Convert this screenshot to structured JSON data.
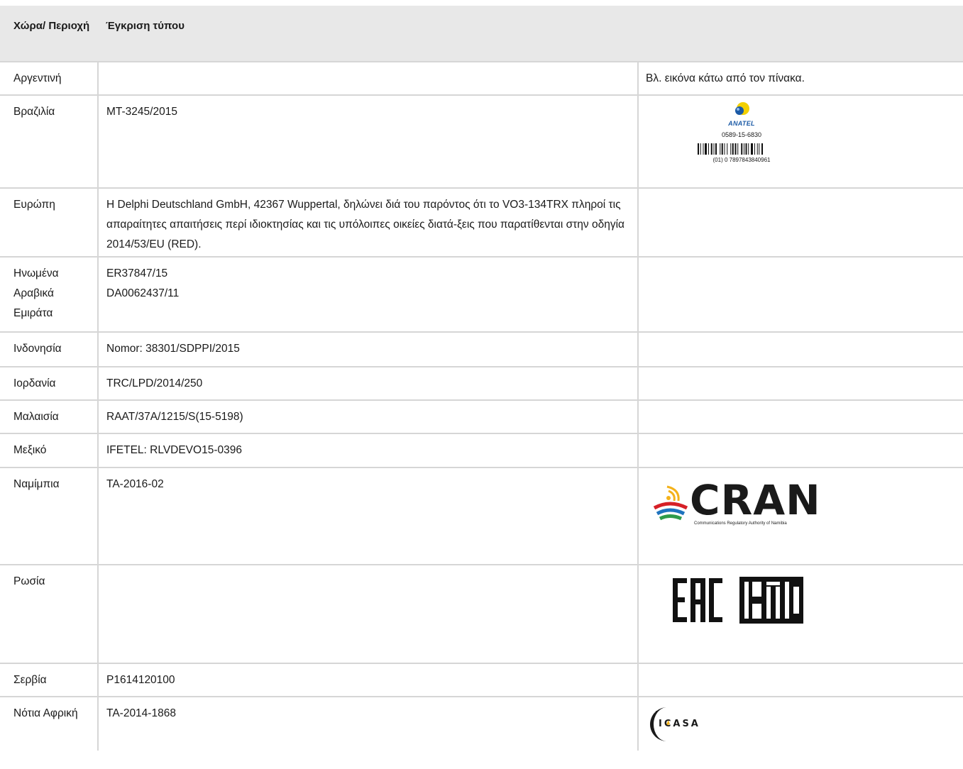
{
  "header": {
    "col_country": "Χώρα/ Περιοχή",
    "col_approval": "Έγκριση τύπου"
  },
  "rows": [
    {
      "country": "Αργεντινή",
      "approval": "",
      "note": "Βλ. εικόνα κάτω από τον πίνακα."
    },
    {
      "country": "Βραζιλία",
      "approval": "MT-3245/2015",
      "logo": {
        "type": "anatel",
        "wordmark": "ANATEL",
        "number": "0589-15-6830",
        "barcode_text": "(01) 0 7897843840961"
      }
    },
    {
      "country": "Ευρώπη",
      "approval": "H Delphi Deutschland GmbH, 42367 Wuppertal, δηλώνει διά του παρόντος ότι το VO3-134TRX πληροί τις απαραίτητες απαιτήσεις περί ιδιοκτησίας και τις υπόλοιπες οικείες διατά-ξεις που παρατίθενται στην οδηγία 2014/53/EU (RED)."
    },
    {
      "country": "Ηνωμένα Αραβικά Εμιράτα",
      "approval_lines": [
        "ER37847/15",
        "DA0062437/11"
      ]
    },
    {
      "country": "Ινδονησία",
      "approval": "Nomor: 38301/SDPPI/2015"
    },
    {
      "country": "Ιορδανία",
      "approval": "TRC/LPD/2014/250"
    },
    {
      "country": "Μαλαισία",
      "approval": "RAAT/37A/1215/S(15-5198)"
    },
    {
      "country": "Μεξικό",
      "approval": "IFETEL: RLVDEVO15-0396"
    },
    {
      "country": "Ναμίμπια",
      "approval": "TA-2016-02",
      "logo": {
        "type": "cran",
        "wordmark": "CRAN",
        "subtitle": "Communications Regulatory Authority of Namibia"
      }
    },
    {
      "country": "Ρωσία",
      "approval": "",
      "logo": {
        "type": "eac",
        "wordmark": "EAC"
      }
    },
    {
      "country": "Σερβία",
      "approval": "P1614120100"
    },
    {
      "country": "Νότια Αφρική",
      "approval": "TA-2014-1868",
      "logo": {
        "type": "icasa",
        "wordmark": "ICASA"
      }
    }
  ],
  "colors": {
    "header_bg": "#e8e8e8",
    "grid_line": "#d6d6d6",
    "text": "#1a1a1a",
    "anatel_blue": "#1b5aa6",
    "anatel_yellow": "#f2d000",
    "cran_red": "#d62027",
    "cran_blue": "#1e73be",
    "cran_green": "#2e9b4a",
    "cran_yellow": "#f4b21b"
  }
}
